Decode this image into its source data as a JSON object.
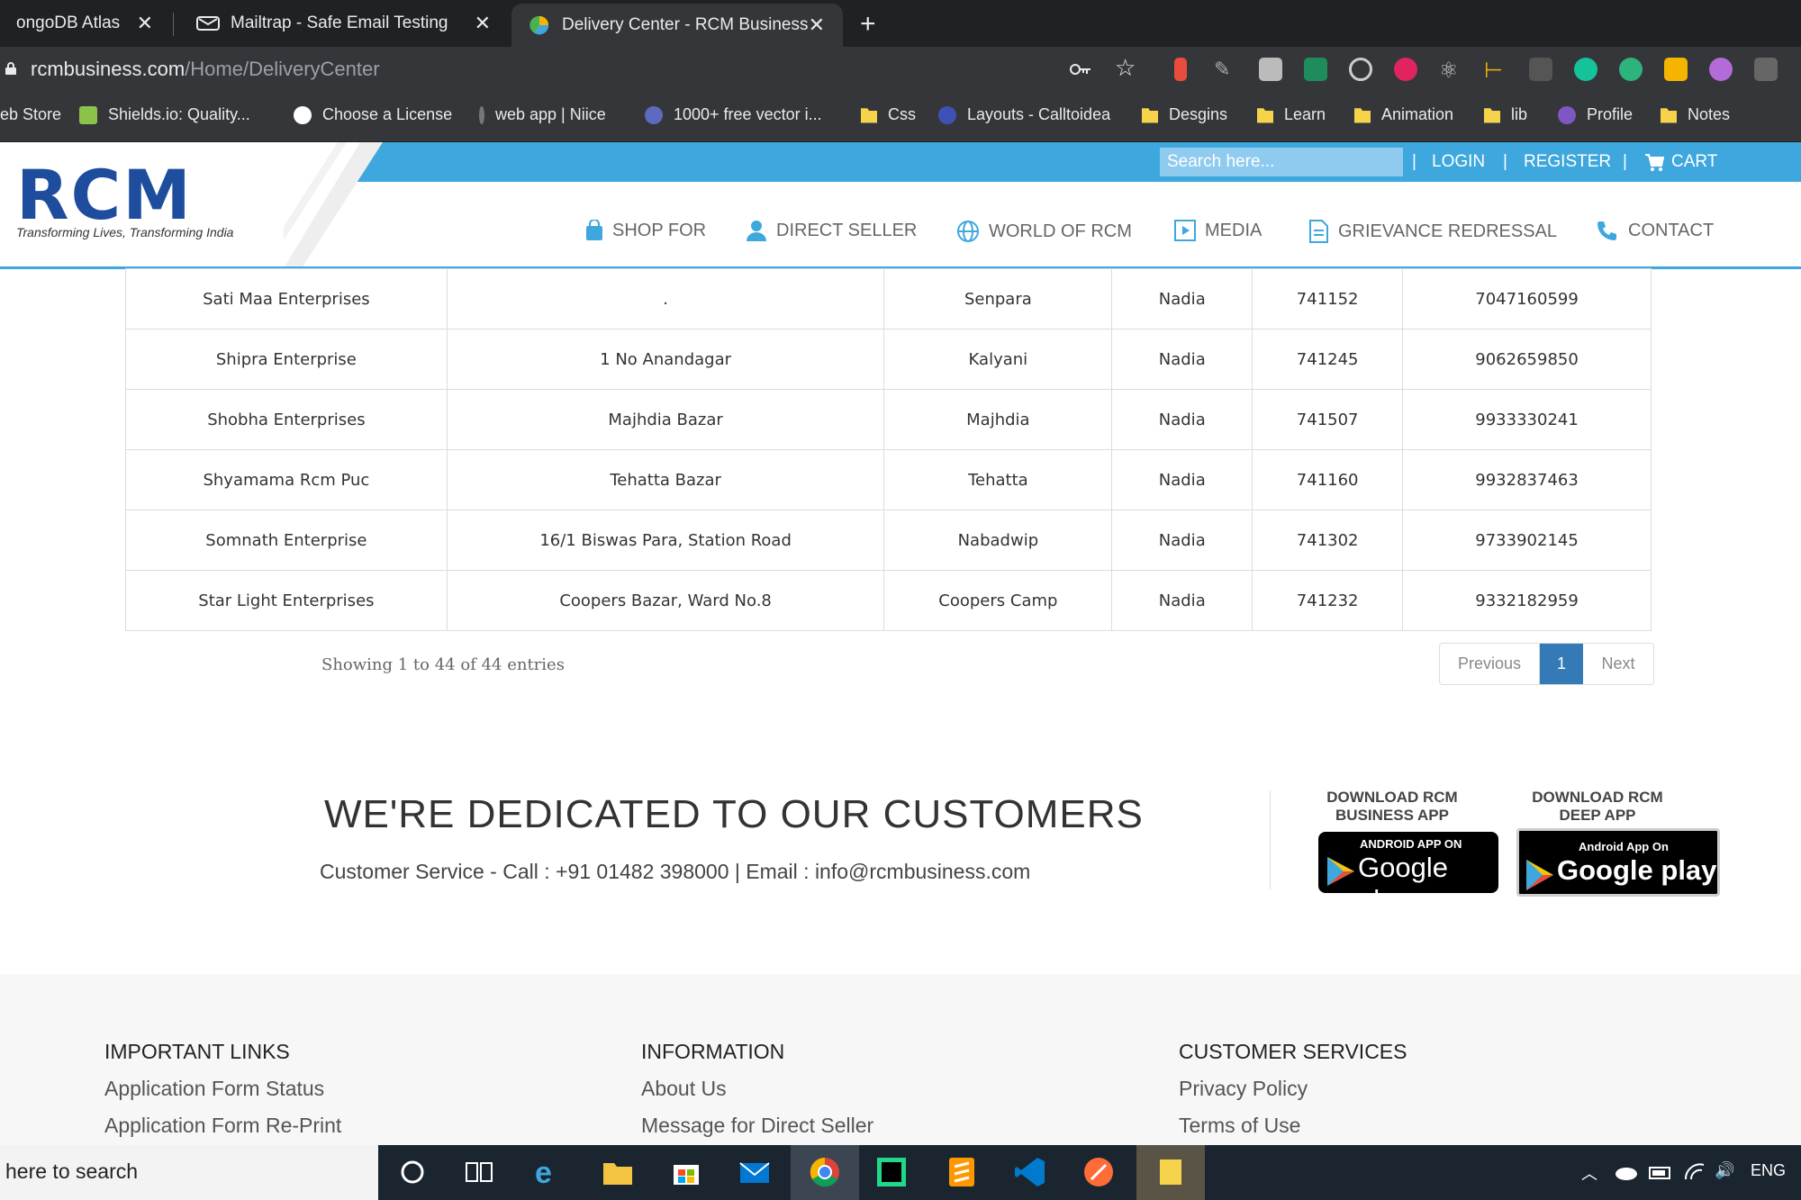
{
  "browser": {
    "tabs": [
      {
        "title": "ongoDB Atlas",
        "active": false
      },
      {
        "title": "Mailtrap - Safe Email Testing",
        "active": false
      },
      {
        "title": "Delivery Center - RCM Business",
        "active": true
      }
    ],
    "url_domain": "rcmbusiness.com",
    "url_path": "/Home/DeliveryCenter",
    "bookmarks": [
      "eb Store",
      "Shields.io: Quality...",
      "Choose a License",
      "web app | Niice",
      "1000+ free vector i...",
      "Css",
      "Layouts - Calltoidea",
      "Desgins",
      "Learn",
      "Animation",
      "lib",
      "Profile",
      "Notes"
    ]
  },
  "header": {
    "search_placeholder": "Search here...",
    "login": "LOGIN",
    "register": "REGISTER",
    "cart": "CART",
    "separator": "|",
    "logo": "RCM",
    "tagline": "Transforming Lives, Transforming India",
    "nav": [
      "SHOP FOR",
      "DIRECT SELLER",
      "WORLD OF RCM",
      "MEDIA",
      "GRIEVANCE REDRESSAL",
      "CONTACT"
    ]
  },
  "table": {
    "rows": [
      [
        "Sati Maa Enterprises",
        ".",
        "Senpara",
        "Nadia",
        "741152",
        "7047160599"
      ],
      [
        "Shipra Enterprise",
        "1 No Anandagar",
        "Kalyani",
        "Nadia",
        "741245",
        "9062659850"
      ],
      [
        "Shobha Enterprises",
        "Majhdia Bazar",
        "Majhdia",
        "Nadia",
        "741507",
        "9933330241"
      ],
      [
        "Shyamama Rcm Puc",
        "Tehatta Bazar",
        "Tehatta",
        "Nadia",
        "741160",
        "9932837463"
      ],
      [
        "Somnath Enterprise",
        "16/1 Biswas Para, Station Road",
        "Nabadwip",
        "Nadia",
        "741302",
        "9733902145"
      ],
      [
        "Star Light Enterprises",
        "Coopers Bazar, Ward No.8",
        "Coopers Camp",
        "Nadia",
        "741232",
        "9332182959"
      ]
    ],
    "showing": "Showing 1 to 44 of 44 entries",
    "pager": {
      "previous": "Previous",
      "current": "1",
      "next": "Next"
    }
  },
  "dedicated": {
    "title": "WE'RE DEDICATED TO OUR CUSTOMERS",
    "contact": "Customer Service - Call : +91 01482 398000 | Email : info@rcmbusiness.com",
    "app1_title": "DOWNLOAD RCM BUSINESS APP",
    "app1_small": "ANDROID APP ON",
    "app1_big": "Google play",
    "app2_title": "DOWNLOAD RCM DEEP APP",
    "app2_small": "Android App On",
    "app2_big": "Google play"
  },
  "footer": {
    "col1_title": "IMPORTANT LINKS",
    "col1_links": [
      "Application Form Status",
      "Application Form Re-Print"
    ],
    "col2_title": "INFORMATION",
    "col2_links": [
      "About Us",
      "Message for Direct Seller"
    ],
    "col3_title": "CUSTOMER SERVICES",
    "col3_links": [
      "Privacy Policy",
      "Terms of Use"
    ]
  },
  "taskbar": {
    "search": "here to search",
    "lang": "ENG"
  },
  "colors": {
    "brand_blue": "#3ea7dd",
    "logo_blue": "#1e4d9e",
    "pager_active": "#337ab7"
  }
}
